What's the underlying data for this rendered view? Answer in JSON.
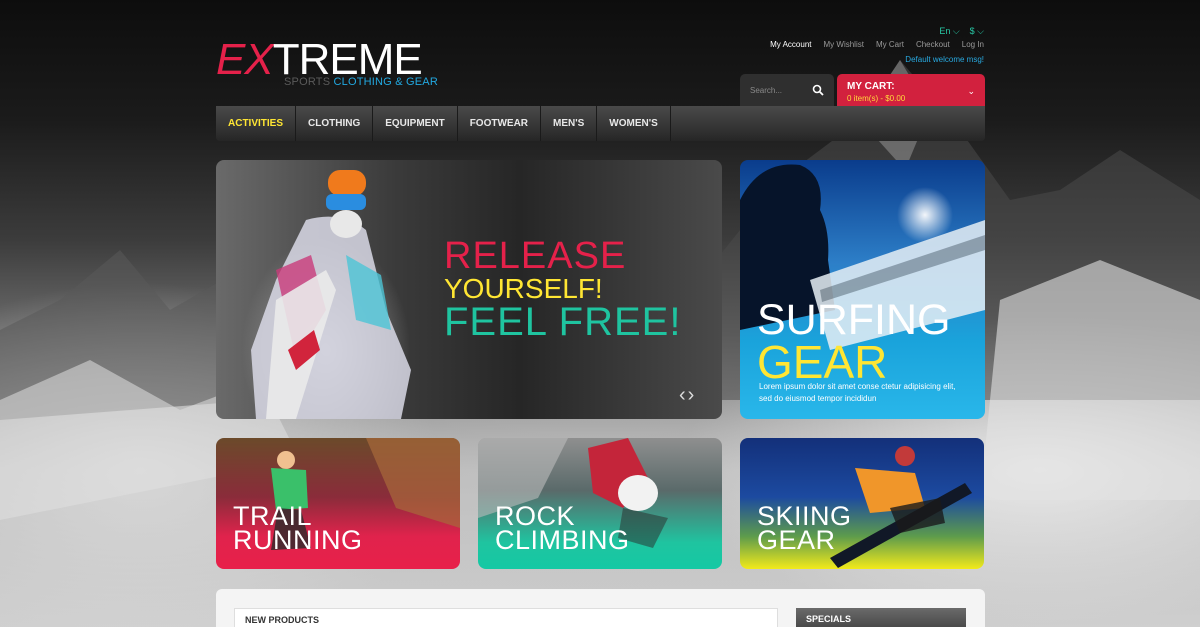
{
  "logo": {
    "prefix": "EX",
    "main": "TREME",
    "sub_a": "SPORTS ",
    "sub_b": "CLOTHING & GEAR"
  },
  "header": {
    "language": "En",
    "currency": "$",
    "links": [
      "My Account",
      "My Wishlist",
      "My Cart",
      "Checkout",
      "Log In"
    ],
    "welcome": "Default welcome msg!"
  },
  "search": {
    "placeholder": "Search..."
  },
  "cart": {
    "title": "MY CART:",
    "summary": "0 item(s) - $0.00"
  },
  "nav": {
    "items": [
      "ACTIVITIES",
      "CLOTHING",
      "EQUIPMENT",
      "FOOTWEAR",
      "MEN'S",
      "WOMEN'S"
    ],
    "active_index": 0
  },
  "hero": {
    "line1": "RELEASE",
    "line2": "YOURSELF!",
    "line3": "FEEL FREE!"
  },
  "surf": {
    "line1": "SURFING",
    "line2": "GEAR",
    "text": "Lorem ipsum dolor sit amet conse ctetur adipisicing elit, sed do eiusmod tempor incididun"
  },
  "banners": [
    {
      "line1": "TRAIL",
      "line2": "RUNNING"
    },
    {
      "line1": "ROCK",
      "line2": "CLIMBING"
    },
    {
      "line1": "SKIING",
      "line2": "GEAR"
    }
  ],
  "sections": {
    "new_products": "NEW PRODUCTS",
    "specials": "SPECIALS"
  },
  "colors": {
    "red": "#e5214a",
    "yellow": "#ffe633",
    "teal": "#1fc4a0",
    "blue": "#22a8e0",
    "cart_red": "#d2213e"
  }
}
